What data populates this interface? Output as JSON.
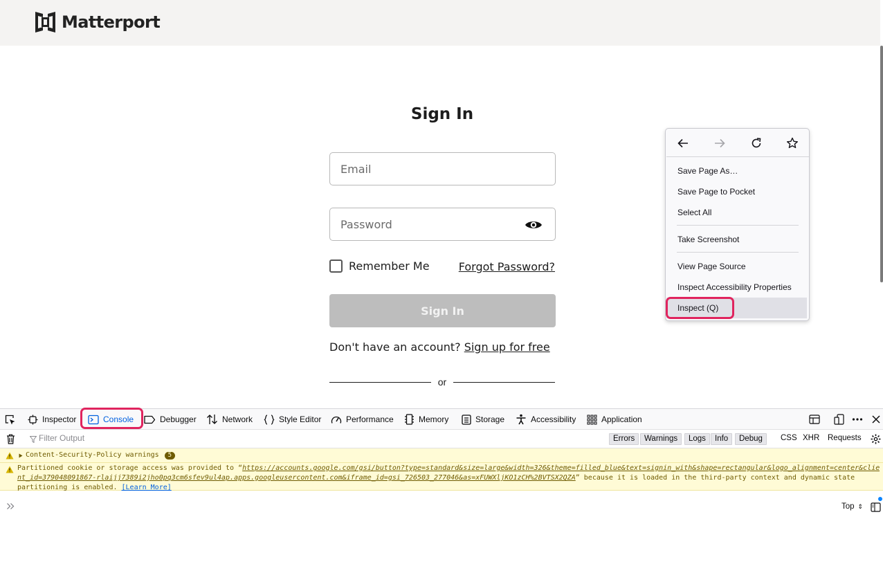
{
  "site": {
    "logo_text": "Matterport"
  },
  "signin": {
    "title": "Sign In",
    "email_placeholder": "Email",
    "password_placeholder": "Password",
    "remember_label": "Remember Me",
    "forgot_label": "Forgot Password?",
    "button_label": "Sign In",
    "no_account_text": "Don't have an account? ",
    "signup_label": "Sign up for free",
    "or_text": "or"
  },
  "context_menu": {
    "items": [
      {
        "label": "Save Page As…"
      },
      {
        "label": "Save Page to Pocket"
      },
      {
        "label": "Select All"
      },
      {
        "label": "Take Screenshot"
      },
      {
        "label": "View Page Source"
      },
      {
        "label": "Inspect Accessibility Properties"
      },
      {
        "label": "Inspect (Q)"
      }
    ],
    "nav_icons": [
      "back-arrow-icon",
      "forward-arrow-icon",
      "reload-icon",
      "bookmark-star-icon"
    ]
  },
  "devtools": {
    "tabs": [
      {
        "label": "Inspector",
        "icon": "inspector-icon"
      },
      {
        "label": "Console",
        "icon": "console-icon"
      },
      {
        "label": "Debugger",
        "icon": "debugger-icon"
      },
      {
        "label": "Network",
        "icon": "network-icon"
      },
      {
        "label": "Style Editor",
        "icon": "style-editor-icon"
      },
      {
        "label": "Performance",
        "icon": "performance-icon"
      },
      {
        "label": "Memory",
        "icon": "memory-icon"
      },
      {
        "label": "Storage",
        "icon": "storage-icon"
      },
      {
        "label": "Accessibility",
        "icon": "accessibility-icon"
      },
      {
        "label": "Application",
        "icon": "application-icon"
      }
    ],
    "filter_placeholder": "Filter Output",
    "levels": [
      "Errors",
      "Warnings",
      "Logs",
      "Info",
      "Debug"
    ],
    "extra_filters": [
      "CSS",
      "XHR",
      "Requests"
    ],
    "messages": {
      "csp_group": "Content-Security-Policy warnings",
      "csp_count": "5",
      "partitioned_prefix": "Partitioned cookie or storage access was provided to “",
      "partitioned_url_line1": "https://accounts.google.com/gsi/button?type=standard&size=large&width=326&theme=filled_blue&text=signin_with&shape=rectangular&logo_alignment=center&clie",
      "partitioned_url_line2": "nt_id=379048091867-rlaijj7389i2jho0pq3cm6sfev9ul4ap.apps.googleusercontent.com&iframe_id=gsi_726503_277046&as=xFUWXljKO1zCH%2BVTSX2QZA",
      "partitioned_suffix": "” because it is loaded in the third-party context and dynamic state",
      "partitioned_line3": "partitioning is enabled. ",
      "learn_more": "[Learn More]"
    },
    "context_selector": "Top"
  },
  "colors": {
    "highlight_ring": "#e0245e",
    "warning_bg": "#fffbd6",
    "link_blue": "#0060df",
    "disabled_button": "#bdbdbd"
  }
}
